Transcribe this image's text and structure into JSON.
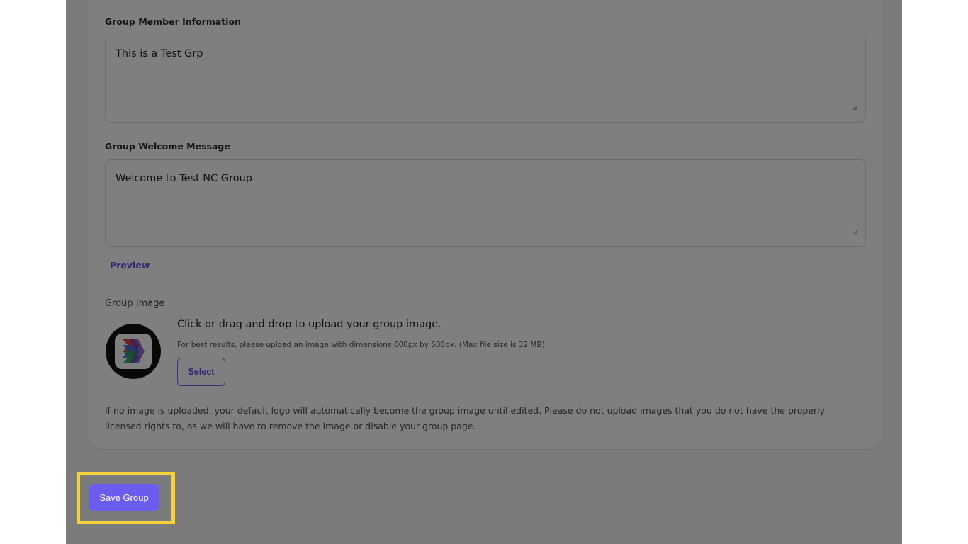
{
  "form": {
    "member_info": {
      "label": "Group Member Information",
      "value": "This is a Test Grp"
    },
    "welcome_message": {
      "label": "Group Welcome Message",
      "value": "Welcome to Test NC Group"
    },
    "preview_link": "Preview",
    "group_image": {
      "label": "Group Image",
      "upload_title": "Click or drag and drop to upload your group image.",
      "upload_hint": "For best results, please upload an image with dimensions 600px by 500px. (Max file size is 32 MB)",
      "select_label": "Select",
      "note": "If no image is uploaded, your default logo will automatically become the group image until edited. Please do not upload images that you do not have the properly licensed rights to, as we will have to remove the image or disable your group page."
    },
    "save_label": "Save Group"
  },
  "colors": {
    "accent": "#6b5cf0",
    "highlight": "#f6d13a",
    "overlay": "rgba(0,0,0,0.5)"
  }
}
